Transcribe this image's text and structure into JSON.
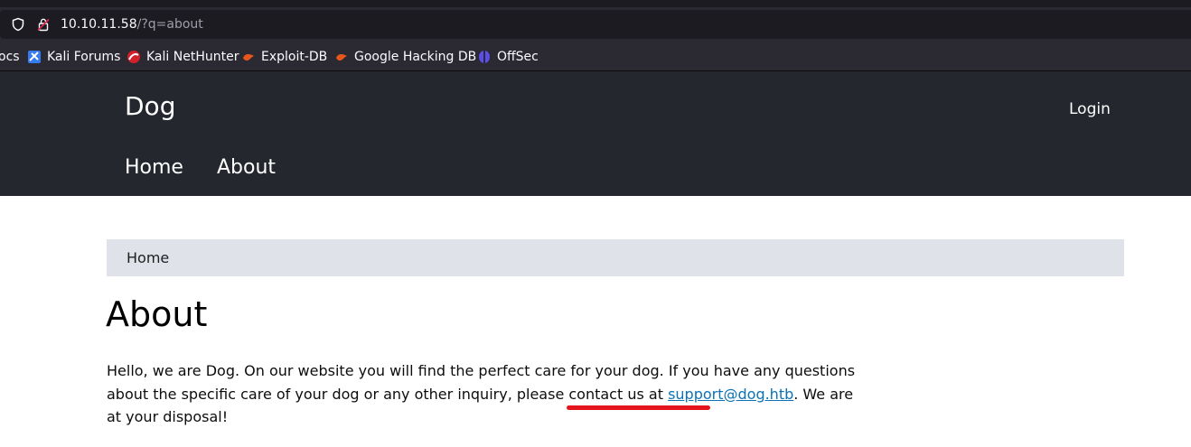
{
  "browser": {
    "url_host": "10.10.11.58",
    "url_path": "/?q=about",
    "bookmarks": [
      {
        "label": "ocs",
        "icon": "none"
      },
      {
        "label": "Kali Forums",
        "icon": "kali-forums-icon"
      },
      {
        "label": "Kali NetHunter",
        "icon": "kali-nethunter-icon"
      },
      {
        "label": "Exploit-DB",
        "icon": "exploit-db-icon"
      },
      {
        "label": "Google Hacking DB",
        "icon": "ghdb-icon"
      },
      {
        "label": "OffSec",
        "icon": "offsec-icon"
      }
    ]
  },
  "site": {
    "name": "Dog",
    "login_label": "Login",
    "nav": [
      {
        "label": "Home"
      },
      {
        "label": "About"
      }
    ]
  },
  "page": {
    "breadcrumb": "Home",
    "title": "About",
    "body_before_link": "Hello, we are Dog. On our website you will find the perfect care for your dog. If you have any questions about the specific care of your dog or any other inquiry, please contact us at ",
    "email_link": "support@dog.htb",
    "body_after_link": ". We are at your disposal!"
  },
  "colors": {
    "header_bg": "#24272e",
    "breadcrumb_bg": "#dfe2e8",
    "link": "#0b72b5",
    "annotation": "#e3141b"
  }
}
